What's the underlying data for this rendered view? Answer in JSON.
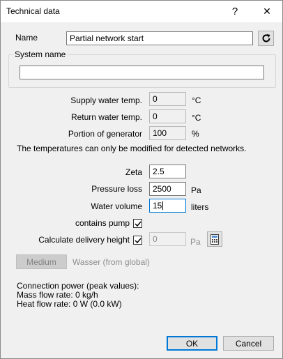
{
  "window": {
    "title": "Technical data",
    "help_label": "?",
    "close_label": "✕"
  },
  "name": {
    "label": "Name",
    "value": "Partial network start"
  },
  "system_name": {
    "label": "System name",
    "value": ""
  },
  "supply_temp": {
    "label": "Supply water temp.",
    "value": "0",
    "unit": "°C"
  },
  "return_temp": {
    "label": "Return water temp.",
    "value": "0",
    "unit": "°C"
  },
  "portion": {
    "label": "Portion of generator",
    "value": "100",
    "unit": "%"
  },
  "info_text": "The temperatures can only be modified for detected networks.",
  "zeta": {
    "label": "Zeta",
    "value": "2.5"
  },
  "pressure_loss": {
    "label": "Pressure loss",
    "value": "2500",
    "unit": "Pa"
  },
  "water_volume": {
    "label": "Water volume",
    "value": "15",
    "unit": "liters"
  },
  "contains_pump": {
    "label": "contains pump",
    "checked": true
  },
  "delivery_height": {
    "label": "Calculate delivery height",
    "checked": true,
    "value": "0",
    "unit": "Pa"
  },
  "medium": {
    "button_label": "Medium",
    "value": "Wasser (from global)"
  },
  "connection": {
    "heading": "Connection power (peak values):",
    "mass_flow": "Mass flow rate: 0 kg/h",
    "heat_flow": "Heat flow rate: 0 W (0.0 kW)"
  },
  "buttons": {
    "ok": "OK",
    "cancel": "Cancel"
  },
  "icons": {
    "refresh": "refresh-icon",
    "calculator": "calculator-icon",
    "help": "help-icon",
    "close": "close-icon"
  }
}
